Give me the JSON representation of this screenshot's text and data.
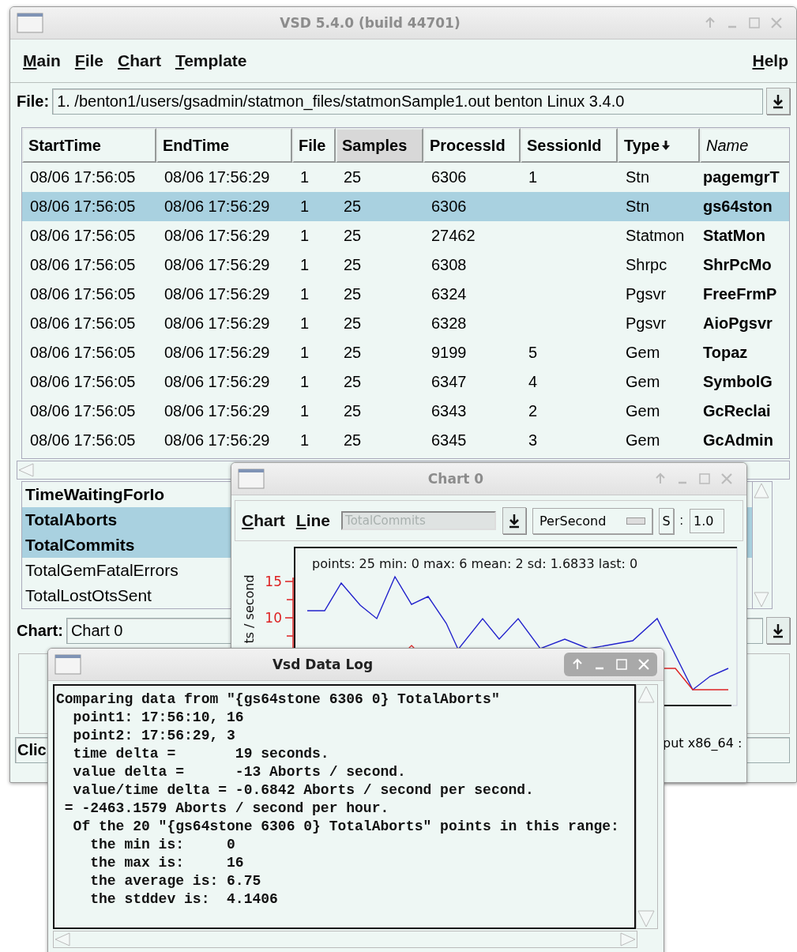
{
  "main_window": {
    "title": "VSD 5.4.0 (build 44701)",
    "active": false,
    "menu": [
      {
        "label": "Main"
      },
      {
        "label": "File"
      },
      {
        "label": "Chart"
      },
      {
        "label": "Template"
      }
    ],
    "help_menu": "Help",
    "file_field": {
      "label": "File:",
      "value": "1. /benton1/users/gsadmin/statmon_files/statmonSample1.out benton Linux 3.4.0"
    },
    "table": {
      "columns": [
        {
          "label": "StartTime",
          "highlighted": false,
          "sorted": false,
          "italic": false
        },
        {
          "label": "EndTime",
          "highlighted": false,
          "sorted": false,
          "italic": false
        },
        {
          "label": "File",
          "highlighted": false,
          "sorted": false,
          "italic": false
        },
        {
          "label": "Samples",
          "highlighted": true,
          "sorted": false,
          "italic": false
        },
        {
          "label": "ProcessId",
          "highlighted": false,
          "sorted": false,
          "italic": false
        },
        {
          "label": "SessionId",
          "highlighted": false,
          "sorted": false,
          "italic": false
        },
        {
          "label": "Type",
          "highlighted": false,
          "sorted": true,
          "italic": false
        },
        {
          "label": "Name",
          "highlighted": false,
          "sorted": false,
          "italic": true
        }
      ],
      "rows": [
        {
          "cells": [
            "08/06 17:56:05",
            "08/06 17:56:29",
            "1",
            "25",
            "6306",
            "1",
            "Stn",
            "pagemgrT"
          ],
          "selected": false
        },
        {
          "cells": [
            "08/06 17:56:05",
            "08/06 17:56:29",
            "1",
            "25",
            "6306",
            "",
            "Stn",
            "gs64ston"
          ],
          "selected": true
        },
        {
          "cells": [
            "08/06 17:56:05",
            "08/06 17:56:29",
            "1",
            "25",
            "27462",
            "",
            "Statmon",
            "StatMon"
          ],
          "selected": false
        },
        {
          "cells": [
            "08/06 17:56:05",
            "08/06 17:56:29",
            "1",
            "25",
            "6308",
            "",
            "Shrpc",
            "ShrPcMo"
          ],
          "selected": false
        },
        {
          "cells": [
            "08/06 17:56:05",
            "08/06 17:56:29",
            "1",
            "25",
            "6324",
            "",
            "Pgsvr",
            "FreeFrmP"
          ],
          "selected": false
        },
        {
          "cells": [
            "08/06 17:56:05",
            "08/06 17:56:29",
            "1",
            "25",
            "6328",
            "",
            "Pgsvr",
            "AioPgsvr"
          ],
          "selected": false
        },
        {
          "cells": [
            "08/06 17:56:05",
            "08/06 17:56:29",
            "1",
            "25",
            "9199",
            "5",
            "Gem",
            "Topaz"
          ],
          "selected": false
        },
        {
          "cells": [
            "08/06 17:56:05",
            "08/06 17:56:29",
            "1",
            "25",
            "6347",
            "4",
            "Gem",
            "SymbolG"
          ],
          "selected": false
        },
        {
          "cells": [
            "08/06 17:56:05",
            "08/06 17:56:29",
            "1",
            "25",
            "6343",
            "2",
            "Gem",
            "GcReclai"
          ],
          "selected": false
        },
        {
          "cells": [
            "08/06 17:56:05",
            "08/06 17:56:29",
            "1",
            "25",
            "6345",
            "3",
            "Gem",
            "GcAdmin"
          ],
          "selected": false
        }
      ]
    },
    "list": {
      "items": [
        {
          "label": "TimeWaitingForIo",
          "bold": true,
          "selected": false
        },
        {
          "label": "TotalAborts",
          "bold": true,
          "selected": true
        },
        {
          "label": "TotalCommits",
          "bold": true,
          "selected": true
        },
        {
          "label": "TotalGemFatalErrors",
          "bold": false,
          "selected": false
        },
        {
          "label": "TotalLostOtsSent",
          "bold": false,
          "selected": false
        }
      ]
    },
    "chart_field": {
      "label": "Chart:",
      "value": "Chart 0"
    },
    "status_field": {
      "value": "Clic"
    }
  },
  "chart_window": {
    "title": "Chart 0",
    "active": false,
    "menu": [
      {
        "label": "Chart"
      },
      {
        "label": "Line"
      }
    ],
    "line_field": {
      "value": "TotalCommits",
      "disabled": true
    },
    "mode_button": "PerSecond",
    "scale_button": "S",
    "scale_separator": ":",
    "scale_field": {
      "value": "1.0"
    },
    "plot": {
      "stats": "points: 25 min: 0 max: 6 mean: 2 sd: 1.6833 last: 0",
      "y_label": "ts / second",
      "y_ticks": [
        "15",
        "10"
      ]
    },
    "legend": "put x86_64 :"
  },
  "log_window": {
    "title": "Vsd Data Log",
    "active": true,
    "lines": [
      "Comparing data from \"{gs64stone 6306 0} TotalAborts\"",
      "  point1: 17:56:10, 16",
      "  point2: 17:56:29, 3",
      "  time delta =       19 seconds.",
      "  value delta =      -13 Aborts / second.",
      "  value/time delta = -0.6842 Aborts / second per second.",
      " = -2463.1579 Aborts / second per hour.",
      "  Of the 20 \"{gs64stone 6306 0} TotalAborts\" points in this range:",
      "    the min is:     0",
      "    the max is:     16",
      "    the average is: 6.75",
      "    the stddev is:  4.1406"
    ]
  }
}
